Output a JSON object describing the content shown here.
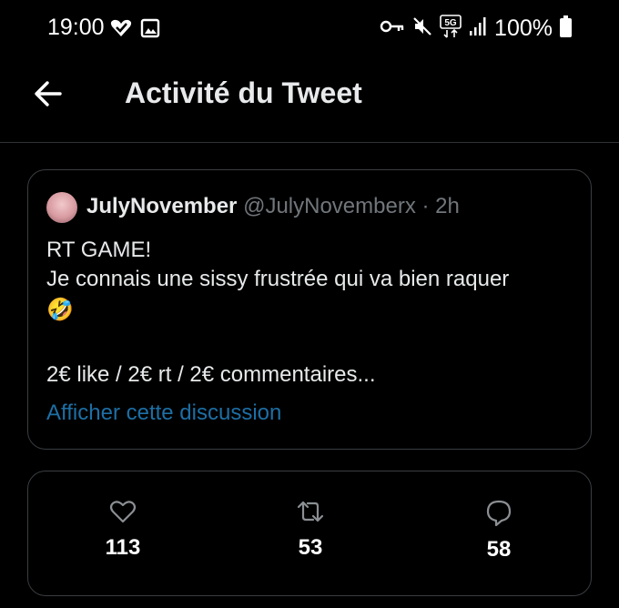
{
  "status_bar": {
    "time": "19:00",
    "battery": "100%",
    "network_badge": "5G",
    "icons": [
      "vpn-heart-icon",
      "image-icon",
      "key-icon",
      "mute-icon",
      "5g-icon",
      "signal-icon",
      "battery-icon"
    ]
  },
  "header": {
    "title": "Activité du Tweet",
    "back_icon": "arrow-left-icon"
  },
  "tweet": {
    "author_name": "JulyNovember",
    "author_handle": "@JulyNovemberx",
    "separator": "·",
    "time_ago": "2h",
    "line1": "RT GAME!",
    "line2": "Je connais une sissy frustrée qui va bien raquer",
    "emoji": "🤣",
    "line3": "2€ like / 2€ rt / 2€ commentaires...",
    "thread_link": "Afficher cette discussion"
  },
  "stats": {
    "likes": "113",
    "retweets": "53",
    "replies": "58"
  },
  "colors": {
    "background": "#000000",
    "text": "#e7e9ea",
    "muted": "#71767b",
    "link": "#1d6fa5",
    "border": "#3a3d41"
  }
}
